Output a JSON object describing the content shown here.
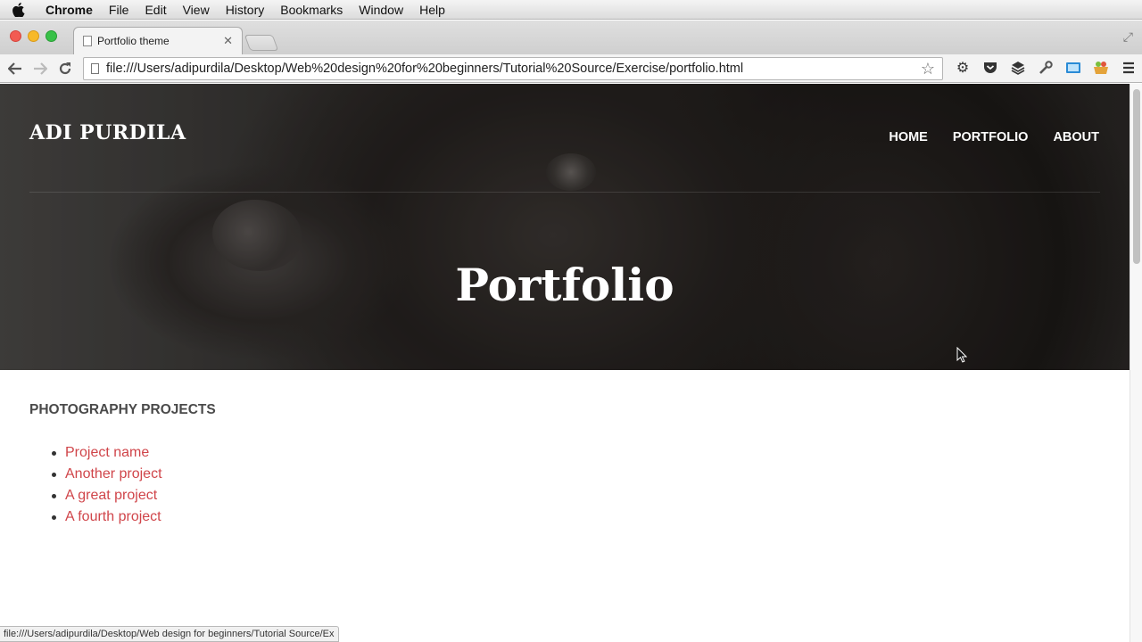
{
  "menubar": {
    "app_name": "Chrome",
    "items": [
      "File",
      "Edit",
      "View",
      "History",
      "Bookmarks",
      "Window",
      "Help"
    ]
  },
  "browser": {
    "tab_title": "Portfolio theme",
    "url": "file:///Users/adipurdila/Desktop/Web%20design%20for%20beginners/Tutorial%20Source/Exercise/portfolio.html",
    "status_text": "file:///Users/adipurdila/Desktop/Web design for beginners/Tutorial Source/Ex"
  },
  "site": {
    "brand": "ADI PURDILA",
    "nav": [
      "HOME",
      "PORTFOLIO",
      "ABOUT"
    ],
    "hero_title": "Portfolio",
    "section_heading": "PHOTOGRAPHY PROJECTS",
    "projects": [
      "Project name",
      "Another project",
      "A great project",
      "A fourth project"
    ]
  },
  "colors": {
    "link": "#d0454a",
    "heading": "#4a4a4a"
  }
}
